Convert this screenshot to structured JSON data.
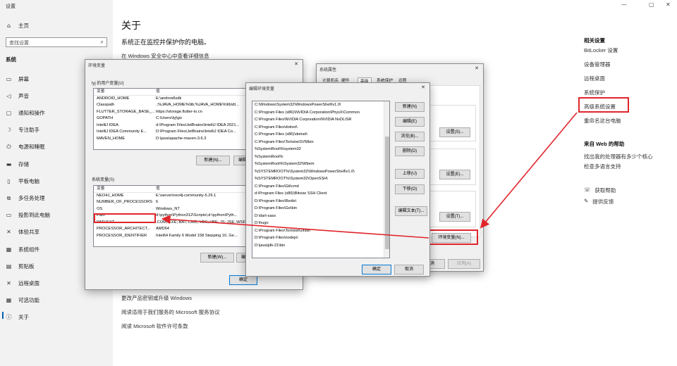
{
  "settings": {
    "window_title": "设置",
    "nav_home": "主页",
    "search_placeholder": "查找设置",
    "section": "系统",
    "nav_items": [
      {
        "label": "屏幕",
        "icon": "monitor-icon",
        "glyph": "▭"
      },
      {
        "label": "声音",
        "icon": "speaker-icon",
        "glyph": "◁"
      },
      {
        "label": "通知和操作",
        "icon": "notification-icon",
        "glyph": "▢"
      },
      {
        "label": "专注助手",
        "icon": "moon-icon",
        "glyph": "☽"
      },
      {
        "label": "电源和睡眠",
        "icon": "power-icon",
        "glyph": "⏻"
      },
      {
        "label": "存储",
        "icon": "storage-icon",
        "glyph": "▬"
      },
      {
        "label": "平板电脑",
        "icon": "tablet-icon",
        "glyph": "▯"
      },
      {
        "label": "多任务处理",
        "icon": "multitask-icon",
        "glyph": "⧉"
      },
      {
        "label": "投影到此电脑",
        "icon": "project-icon",
        "glyph": "▭"
      },
      {
        "label": "体验共享",
        "icon": "share-icon",
        "glyph": "✕"
      },
      {
        "label": "系统组件",
        "icon": "components-icon",
        "glyph": "▦"
      },
      {
        "label": "剪贴板",
        "icon": "clipboard-icon",
        "glyph": "▤"
      },
      {
        "label": "远程桌面",
        "icon": "remote-icon",
        "glyph": "✕"
      },
      {
        "label": "可选功能",
        "icon": "optional-icon",
        "glyph": "▦"
      },
      {
        "label": "关于",
        "icon": "info-icon",
        "glyph": "ⓘ"
      }
    ]
  },
  "main": {
    "title": "关于",
    "subtitle": "系统正在监控并保护你的电脑。",
    "security_link": "在 Windows 安全中心中查看详细信息",
    "bottom_links": [
      "更改产品密钥或升级 Windows",
      "阅读适用于我们服务的 Microsoft 服务协议",
      "阅读 Microsoft 软件许可条款"
    ]
  },
  "right": {
    "related_title": "相关设置",
    "related_links": [
      "BitLocker 设置",
      "设备管理器",
      "远程桌面",
      "系统保护",
      "高级系统设置",
      "重命名这台电脑"
    ],
    "help_title": "来自 Web 的帮助",
    "help_links": [
      "找出我的处理器有多少个核心",
      "检查多语言支持"
    ],
    "get_help": "获取帮助",
    "feedback": "提供反馈"
  },
  "env_dialog": {
    "title": "环境变量",
    "user_group": "lyj 的用户变量(U)",
    "col_var": "变量",
    "col_val": "值",
    "user_vars": [
      [
        "ANDROID_HOME",
        "E:\\android\\sdk"
      ],
      [
        "Classpath",
        ".;%JAVA_HOME%\\lib;%JAVA_HOME%\\lib\\dt..."
      ],
      [
        "FLUTTER_STORAGE_BASE_...",
        "https://storage.flutter-io.cn"
      ],
      [
        "GOPATH",
        "C:\\Users\\lyj\\go"
      ],
      [
        "IntelliJ IDEA",
        "d:\\Program Files\\JetBrains\\IntelliJ IDEA 2021..."
      ],
      [
        "IntelliJ IDEA Community E...",
        "D:\\Program Files\\JetBrains\\IntelliJ IDEA Co..."
      ],
      [
        "MAVEN_HOME",
        "D:\\java\\apache-maven-3.6.3"
      ]
    ],
    "user_new": "新建(N)...",
    "user_edit": "编辑",
    "sys_group": "系统变量(S)",
    "sys_vars": [
      [
        "NEO4J_HOME",
        "E:\\server\\neo4j-community-5.26.1"
      ],
      [
        "NUMBER_OF_PROCESSORS",
        "6"
      ],
      [
        "OS",
        "Windows_NT"
      ],
      [
        "Path",
        "d:\\python\\Python312\\Scripts\\;d:\\python\\Pyth..."
      ],
      [
        "PATHEXT",
        ".COM;.EXE;.BAT;.CMD;.VBS;.VBE;.JS;.JSE;.WSF..."
      ],
      [
        "PROCESSOR_ARCHITECT...",
        "AMD64"
      ],
      [
        "PROCESSOR_IDENTIFIER",
        "Intel64 Family 6 Model 158 Stepping 10, Ge..."
      ]
    ],
    "sys_new": "新建(W)...",
    "sys_edit": "编辑",
    "ok": "确定"
  },
  "props_dialog": {
    "title": "系统属性",
    "tabs": [
      "计算机名",
      "硬件",
      "高级",
      "系统保护",
      "远程"
    ],
    "settings_btn": "设置(S)...",
    "settings_btn2": "设置(E)...",
    "settings_btn3": "设置(T)...",
    "env_btn": "环境变量(N)...",
    "cancel": "取消",
    "apply": "应用(A)"
  },
  "edit_dialog": {
    "title": "编辑环境变量",
    "paths": [
      "C:\\Windows\\System32\\WindowsPowerShell\\v1.0\\",
      "C:\\Program Files (x86)\\NVIDIA Corporation\\PhysX\\Common",
      "C:\\Program Files\\NVIDIA Corporation\\NVIDIA NvDLISR",
      "C:\\Program Files\\dotnet\\",
      "C:\\Program Files (x86)\\dotnet\\",
      "C:\\Program Files\\TortoiseSVN\\bin",
      "%SystemRoot%\\system32",
      "%SystemRoot%",
      "%SystemRoot%\\System32\\Wbem",
      "%SYSTEMROOT%\\System32\\WindowsPowerShell\\v1.0\\",
      "%SYSTEMROOT%\\System32\\OpenSSH\\",
      "C:\\Program Files\\Git\\cmd",
      "d:\\Program Files (x86)\\Bitvise SSH Client",
      "D:\\Program Files\\Redis\\",
      "D:\\Program Files\\Go\\bin",
      "D:\\dart-sass",
      "D:\\hugo",
      "C:\\Program Files\\TortoiseGit\\bin",
      "D:\\Program Files\\nodejs\\",
      "D:\\java\\jdk-21\\bin"
    ],
    "btn_new": "新建(N)",
    "btn_edit": "编辑(E)",
    "btn_browse": "浏览(B)...",
    "btn_delete": "删除(D)",
    "btn_up": "上移(U)",
    "btn_down": "下移(O)",
    "btn_edit_text": "编辑文本(T)...",
    "ok": "确定",
    "cancel": "取消"
  },
  "colors": {
    "highlight": "#e0252b",
    "accent": "#0078d7"
  }
}
